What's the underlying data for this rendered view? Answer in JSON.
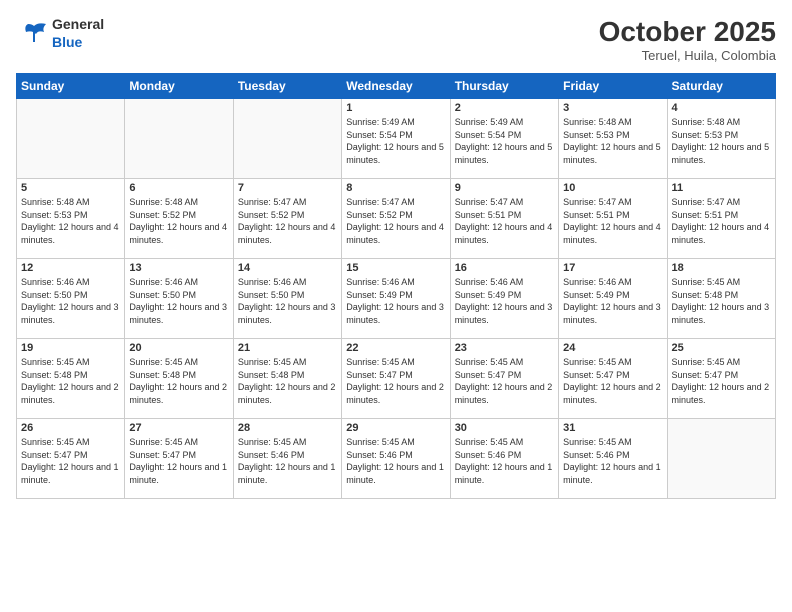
{
  "header": {
    "logo_line1": "General",
    "logo_line2": "Blue",
    "month_title": "October 2025",
    "subtitle": "Teruel, Huila, Colombia"
  },
  "days_of_week": [
    "Sunday",
    "Monday",
    "Tuesday",
    "Wednesday",
    "Thursday",
    "Friday",
    "Saturday"
  ],
  "weeks": [
    [
      {
        "day": "",
        "empty": true
      },
      {
        "day": "",
        "empty": true
      },
      {
        "day": "",
        "empty": true
      },
      {
        "day": "1",
        "sunrise": "5:49 AM",
        "sunset": "5:54 PM",
        "daylight": "12 hours and 5 minutes."
      },
      {
        "day": "2",
        "sunrise": "5:49 AM",
        "sunset": "5:54 PM",
        "daylight": "12 hours and 5 minutes."
      },
      {
        "day": "3",
        "sunrise": "5:48 AM",
        "sunset": "5:53 PM",
        "daylight": "12 hours and 5 minutes."
      },
      {
        "day": "4",
        "sunrise": "5:48 AM",
        "sunset": "5:53 PM",
        "daylight": "12 hours and 5 minutes."
      }
    ],
    [
      {
        "day": "5",
        "sunrise": "5:48 AM",
        "sunset": "5:53 PM",
        "daylight": "12 hours and 4 minutes."
      },
      {
        "day": "6",
        "sunrise": "5:48 AM",
        "sunset": "5:52 PM",
        "daylight": "12 hours and 4 minutes."
      },
      {
        "day": "7",
        "sunrise": "5:47 AM",
        "sunset": "5:52 PM",
        "daylight": "12 hours and 4 minutes."
      },
      {
        "day": "8",
        "sunrise": "5:47 AM",
        "sunset": "5:52 PM",
        "daylight": "12 hours and 4 minutes."
      },
      {
        "day": "9",
        "sunrise": "5:47 AM",
        "sunset": "5:51 PM",
        "daylight": "12 hours and 4 minutes."
      },
      {
        "day": "10",
        "sunrise": "5:47 AM",
        "sunset": "5:51 PM",
        "daylight": "12 hours and 4 minutes."
      },
      {
        "day": "11",
        "sunrise": "5:47 AM",
        "sunset": "5:51 PM",
        "daylight": "12 hours and 4 minutes."
      }
    ],
    [
      {
        "day": "12",
        "sunrise": "5:46 AM",
        "sunset": "5:50 PM",
        "daylight": "12 hours and 3 minutes."
      },
      {
        "day": "13",
        "sunrise": "5:46 AM",
        "sunset": "5:50 PM",
        "daylight": "12 hours and 3 minutes."
      },
      {
        "day": "14",
        "sunrise": "5:46 AM",
        "sunset": "5:50 PM",
        "daylight": "12 hours and 3 minutes."
      },
      {
        "day": "15",
        "sunrise": "5:46 AM",
        "sunset": "5:49 PM",
        "daylight": "12 hours and 3 minutes."
      },
      {
        "day": "16",
        "sunrise": "5:46 AM",
        "sunset": "5:49 PM",
        "daylight": "12 hours and 3 minutes."
      },
      {
        "day": "17",
        "sunrise": "5:46 AM",
        "sunset": "5:49 PM",
        "daylight": "12 hours and 3 minutes."
      },
      {
        "day": "18",
        "sunrise": "5:45 AM",
        "sunset": "5:48 PM",
        "daylight": "12 hours and 3 minutes."
      }
    ],
    [
      {
        "day": "19",
        "sunrise": "5:45 AM",
        "sunset": "5:48 PM",
        "daylight": "12 hours and 2 minutes."
      },
      {
        "day": "20",
        "sunrise": "5:45 AM",
        "sunset": "5:48 PM",
        "daylight": "12 hours and 2 minutes."
      },
      {
        "day": "21",
        "sunrise": "5:45 AM",
        "sunset": "5:48 PM",
        "daylight": "12 hours and 2 minutes."
      },
      {
        "day": "22",
        "sunrise": "5:45 AM",
        "sunset": "5:47 PM",
        "daylight": "12 hours and 2 minutes."
      },
      {
        "day": "23",
        "sunrise": "5:45 AM",
        "sunset": "5:47 PM",
        "daylight": "12 hours and 2 minutes."
      },
      {
        "day": "24",
        "sunrise": "5:45 AM",
        "sunset": "5:47 PM",
        "daylight": "12 hours and 2 minutes."
      },
      {
        "day": "25",
        "sunrise": "5:45 AM",
        "sunset": "5:47 PM",
        "daylight": "12 hours and 2 minutes."
      }
    ],
    [
      {
        "day": "26",
        "sunrise": "5:45 AM",
        "sunset": "5:47 PM",
        "daylight": "12 hours and 1 minute."
      },
      {
        "day": "27",
        "sunrise": "5:45 AM",
        "sunset": "5:47 PM",
        "daylight": "12 hours and 1 minute."
      },
      {
        "day": "28",
        "sunrise": "5:45 AM",
        "sunset": "5:46 PM",
        "daylight": "12 hours and 1 minute."
      },
      {
        "day": "29",
        "sunrise": "5:45 AM",
        "sunset": "5:46 PM",
        "daylight": "12 hours and 1 minute."
      },
      {
        "day": "30",
        "sunrise": "5:45 AM",
        "sunset": "5:46 PM",
        "daylight": "12 hours and 1 minute."
      },
      {
        "day": "31",
        "sunrise": "5:45 AM",
        "sunset": "5:46 PM",
        "daylight": "12 hours and 1 minute."
      },
      {
        "day": "",
        "empty": true
      }
    ]
  ]
}
